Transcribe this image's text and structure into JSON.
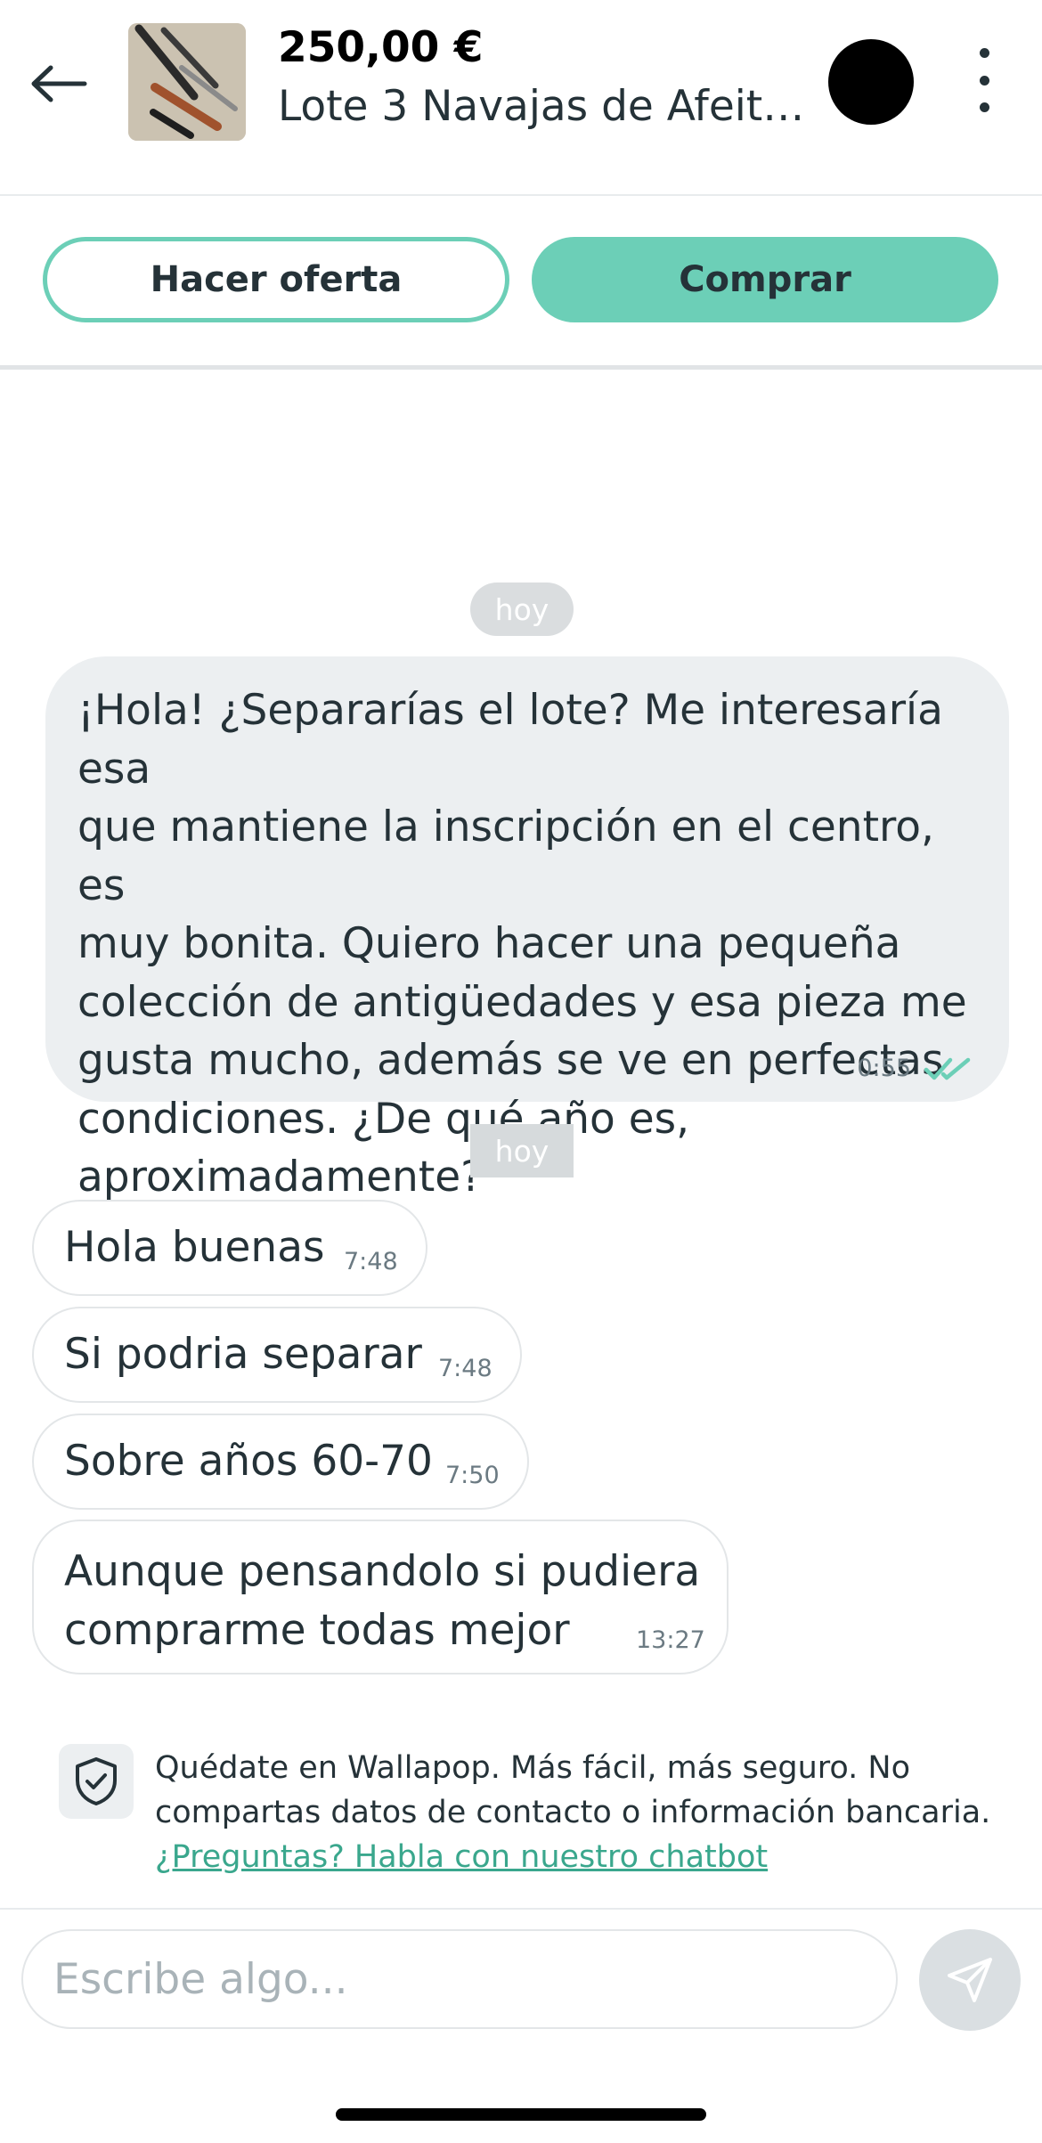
{
  "header": {
    "back_icon": "arrow-left-icon",
    "price": "250,00 €",
    "title": "Lote 3 Navajas de Afeitar...",
    "menu_icon": "more-vertical-icon"
  },
  "actions": {
    "offer_label": "Hacer oferta",
    "buy_label": "Comprar"
  },
  "colors": {
    "accent": "#6ccfb7",
    "link": "#3aa78d",
    "bubble_sent": "#eceff1",
    "text": "#253238"
  },
  "messages": {
    "day_1": "hoy",
    "sent": {
      "lines": [
        "¡Hola! ¿Separarías el lote? Me interesaría esa",
        "que mantiene la inscripción en el centro, es",
        "muy bonita. Quiero hacer una pequeña",
        "colección de antigüedades y esa pieza me",
        "gusta mucho, además se ve en perfectas",
        "condiciones. ¿De qué año es,",
        "aproximadamente?"
      ],
      "time": "0:55",
      "status_icon": "double-check-icon"
    },
    "day_2": "hoy",
    "received": [
      {
        "text": "Hola buenas",
        "time": "7:48"
      },
      {
        "text": "Si podria separar",
        "time": "7:48"
      },
      {
        "text": "Sobre años 60-70",
        "time": "7:50"
      },
      {
        "lines": [
          "Aunque pensandolo si pudiera",
          "comprarme todas mejor"
        ],
        "time": "13:27"
      }
    ]
  },
  "notice": {
    "icon": "shield-check-icon",
    "text": "Quédate en Wallapop. Más fácil, más seguro. No compartas datos de contacto o información bancaria.",
    "link": "¿Preguntas? Habla con nuestro chatbot"
  },
  "composer": {
    "placeholder": "Escribe algo...",
    "send_icon": "send-icon"
  }
}
